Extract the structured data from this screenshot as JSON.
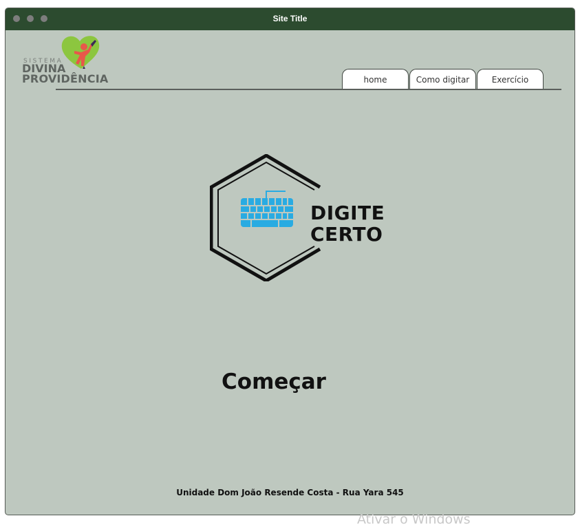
{
  "window": {
    "title": "Site Title"
  },
  "brand": {
    "line1": "SISTEMA",
    "line2": "DIVINA",
    "line3": "PROVIDÊNCIA",
    "colors": {
      "heart_green": "#8cc63f",
      "figure_red": "#e8574a",
      "figure_dark": "#3b2a56",
      "text_gray": "#5f6561"
    }
  },
  "nav": {
    "tabs": [
      {
        "label": "home"
      },
      {
        "label": "Como digitar"
      },
      {
        "label": "Exercício"
      }
    ]
  },
  "logo": {
    "line1": "DIGITE",
    "line2": "CERTO",
    "icon": "keyboard-icon",
    "keyboard_color": "#29abe2"
  },
  "main": {
    "start_label": "Começar"
  },
  "footer": {
    "text": "Unidade Dom João Resende Costa - Rua Yara 545"
  },
  "overlay": {
    "watermark": "Ativar o Windows"
  },
  "colors": {
    "titlebar": "#2c4b2f",
    "background": "#bec8bf"
  }
}
